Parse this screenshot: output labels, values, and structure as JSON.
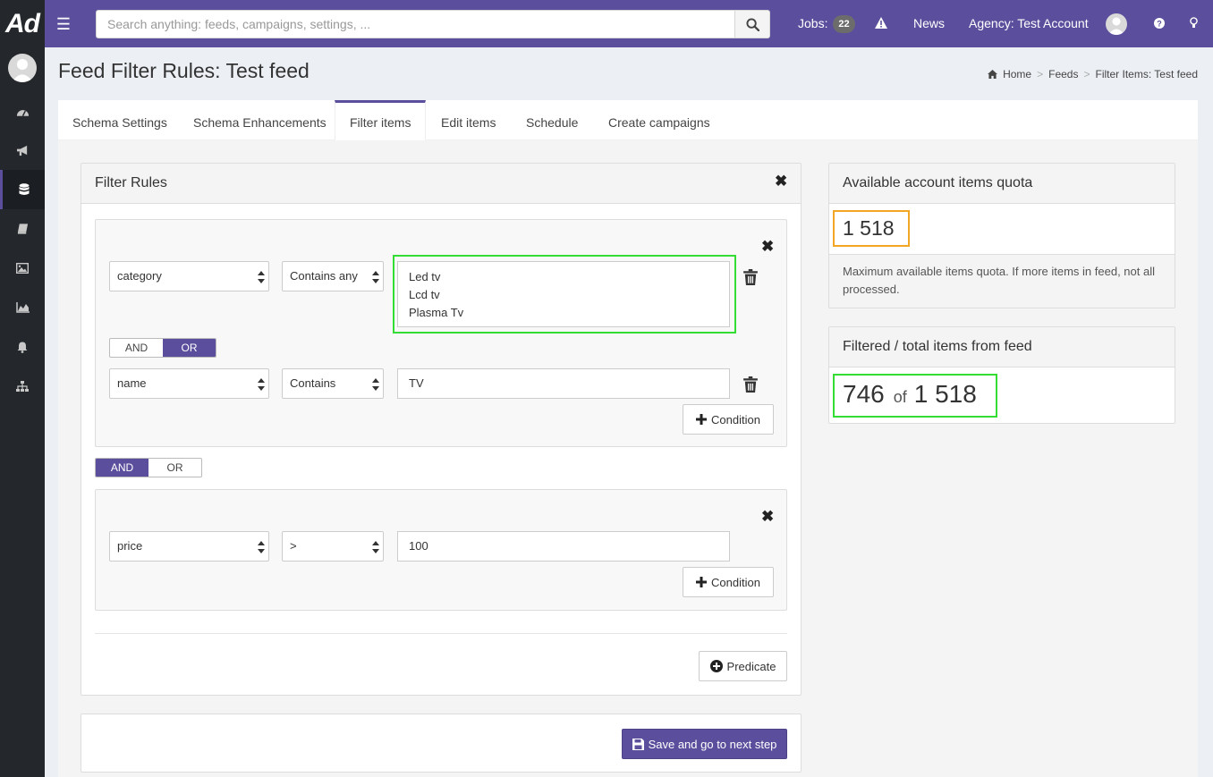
{
  "app": {
    "logo_text": "Ad"
  },
  "header": {
    "search_placeholder": "Search anything: feeds, campaigns, settings, ...",
    "jobs_label": "Jobs:",
    "jobs_count": "22",
    "news_label": "News",
    "agency_label": "Agency: Test Account"
  },
  "page": {
    "title": "Feed Filter Rules: Test feed",
    "breadcrumb": [
      "Home",
      "Feeds",
      "Filter Items: Test feed"
    ]
  },
  "tabs": [
    {
      "label": "Schema Settings",
      "active": false
    },
    {
      "label": "Schema Enhancements",
      "active": false
    },
    {
      "label": "Filter items",
      "active": true
    },
    {
      "label": "Edit items",
      "active": false
    },
    {
      "label": "Schedule",
      "active": false
    },
    {
      "label": "Create campaigns",
      "active": false
    }
  ],
  "filter_rules": {
    "title": "Filter Rules",
    "group1": {
      "cond1": {
        "field": "category",
        "operator": "Contains any",
        "values": [
          "Led tv",
          "Lcd tv",
          "Plasma Tv"
        ]
      },
      "toggle": {
        "and": "AND",
        "or": "OR",
        "selected": "OR"
      },
      "cond2": {
        "field": "name",
        "operator": "Contains",
        "value": "TV"
      },
      "add_condition": "Condition"
    },
    "between_toggle": {
      "and": "AND",
      "or": "OR",
      "selected": "AND"
    },
    "group2": {
      "cond1": {
        "field": "price",
        "operator": ">",
        "value": "100"
      },
      "add_condition": "Condition"
    },
    "add_predicate": "Predicate",
    "save_button": "Save and go to next step"
  },
  "quota_panel": {
    "title": "Available account items quota",
    "value": "1 518",
    "note": "Maximum available items quota. If more items in feed, not all processed."
  },
  "filtered_panel": {
    "title": "Filtered / total items from feed",
    "filtered": "746",
    "of": "of",
    "total": "1 518"
  },
  "colors": {
    "brand": "#5b4f9d",
    "sidebar": "#24282d",
    "highlight_green": "#33dd33",
    "highlight_orange": "#f2a623"
  }
}
